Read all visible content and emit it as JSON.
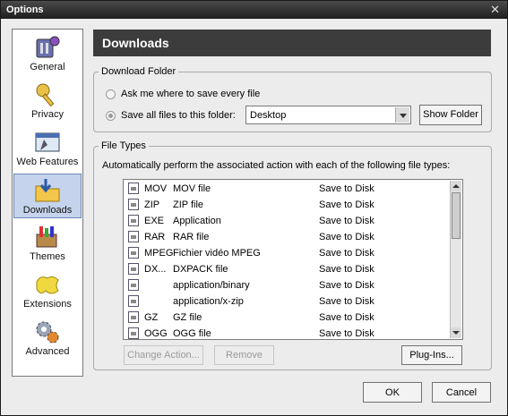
{
  "window": {
    "title": "Options",
    "close_glyph": "✕",
    "help_glyph": "?"
  },
  "nav": {
    "items": [
      {
        "label": "General",
        "icon": "general-icon"
      },
      {
        "label": "Privacy",
        "icon": "privacy-key-icon"
      },
      {
        "label": "Web Features",
        "icon": "web-features-icon"
      },
      {
        "label": "Downloads",
        "icon": "downloads-folder-icon",
        "selected": true
      },
      {
        "label": "Themes",
        "icon": "themes-paint-icon"
      },
      {
        "label": "Extensions",
        "icon": "extensions-puzzle-icon"
      },
      {
        "label": "Advanced",
        "icon": "advanced-gears-icon"
      }
    ]
  },
  "header": {
    "title": "Downloads"
  },
  "download_folder": {
    "group_label": "Download Folder",
    "ask_label": "Ask me where to save every file",
    "save_all_label": "Save all files to this folder:",
    "selected_option": "save_all",
    "folder_value": "Desktop",
    "show_folder_label": "Show Folder"
  },
  "file_types": {
    "group_label": "File Types",
    "description": "Automatically perform the associated action with each of the following file types:",
    "rows": [
      {
        "ext": "MOV",
        "desc": "MOV file",
        "action": "Save to Disk"
      },
      {
        "ext": "ZIP",
        "desc": "ZIP file",
        "action": "Save to Disk"
      },
      {
        "ext": "EXE",
        "desc": "Application",
        "action": "Save to Disk"
      },
      {
        "ext": "RAR",
        "desc": "RAR file",
        "action": "Save to Disk"
      },
      {
        "ext": "MPEG",
        "desc": "Fichier vidéo MPEG",
        "action": "Save to Disk"
      },
      {
        "ext": "DX...",
        "desc": "DXPACK file",
        "action": "Save to Disk"
      },
      {
        "ext": "",
        "desc": "application/binary",
        "action": "Save to Disk"
      },
      {
        "ext": "",
        "desc": "application/x-zip",
        "action": "Save to Disk"
      },
      {
        "ext": "GZ",
        "desc": "GZ file",
        "action": "Save to Disk"
      },
      {
        "ext": "OGG",
        "desc": "OGG file",
        "action": "Save to Disk"
      }
    ],
    "change_action_label": "Change Action...",
    "remove_label": "Remove",
    "plugins_label": "Plug-Ins..."
  },
  "footer": {
    "ok_label": "OK",
    "cancel_label": "Cancel"
  }
}
